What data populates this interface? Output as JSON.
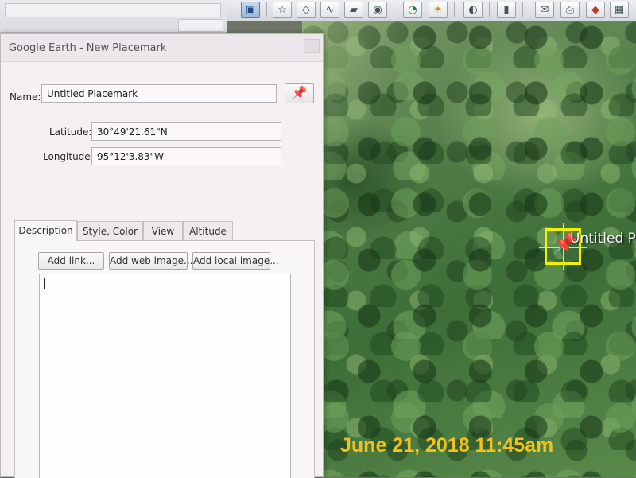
{
  "dialog": {
    "title": "Google Earth - New Placemark",
    "name_label": "Name:",
    "name_value": "Untitled Placemark",
    "latitude_label": "Latitude:",
    "latitude_value": "30°49'21.61\"N",
    "longitude_label": "Longitude:",
    "longitude_value": "95°12'3.83\"W",
    "tabs": [
      {
        "label": "Description",
        "active": true
      },
      {
        "label": "Style, Color",
        "active": false
      },
      {
        "label": "View",
        "active": false
      },
      {
        "label": "Altitude",
        "active": false
      }
    ],
    "buttons": {
      "add_link": "Add link...",
      "add_web_image": "Add web image...",
      "add_local_image": "Add local image..."
    },
    "description_value": ""
  },
  "map": {
    "placemark_label": "Untitled P",
    "timestamp": "June 21, 2018 11:45am",
    "colors": {
      "placemark_highlight": "#f2f000",
      "timestamp": "#f2c21b"
    }
  },
  "toolbar": {
    "icons": [
      "sidebar-toggle-icon",
      "add-placemark-icon",
      "add-polygon-icon",
      "add-path-icon",
      "add-image-overlay-icon",
      "record-tour-icon",
      "historical-imagery-icon",
      "sunlight-icon",
      "planets-icon",
      "ruler-icon",
      "email-icon",
      "print-icon",
      "view-in-maps-icon",
      "gallery-icon"
    ]
  }
}
